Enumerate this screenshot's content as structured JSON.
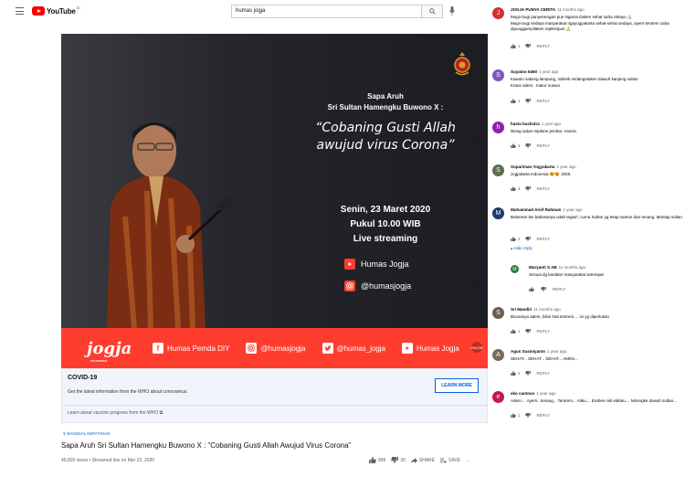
{
  "header": {
    "logo_text": "YouTube",
    "region_code": "ID",
    "search_value": "humas jogja"
  },
  "video": {
    "overlay": {
      "line1": "Sapa Aruh",
      "line2": "Sri Sultan Hamengku Buwono X :",
      "quote1": "“Cobaning Gusti Allah",
      "quote2": "awujud virus Corona”",
      "date": "Senin, 23 Maret 2020",
      "time": "Pukul 10.00 WIB",
      "live": "Live streaming",
      "social1": "Humas Jogja",
      "social2": "@humasjogja"
    },
    "bar": {
      "brand": "jogja",
      "brand_tag": "ISTIMEWA",
      "items": [
        "Humas Pemda DIY",
        "@humasjogja",
        "@humas_jogja",
        "Humas Jogja"
      ],
      "pause": "PAUSE"
    }
  },
  "info_panel": {
    "title": "COVID-19",
    "text": "Get the latest information from the WHO about coronavirus.",
    "link": "Learn about vaccine progress from the WHO ⧉",
    "button": "LEARN MORE"
  },
  "meta": {
    "location": "BANSSAL KEPATIHAN",
    "title": "Sapa Aruh Sri Sultan Hamengku Buwono X : “Cobaning Gusti Allah Awujud Virus Corona”",
    "stats": "49,820 views • Streamed live on Mar 23, 2020",
    "likes": "999",
    "dislikes": "30",
    "share": "SHARE",
    "save": "SAVE",
    "more": "..."
  },
  "comments": [
    {
      "author": "JOGJA PUNYA CERITA",
      "time": "11 months ago",
      "body": "Mugi-mugi panyenengan pun Ngarsa Dalem sehat saha rahayu 🙏\nMugi-mugi sedaya masyarakat ngayogyakarta sehat-sehat sedaya, ayem tentrem saha dipunggampilaken rejekinipun 🙏",
      "likes": "1",
      "reply": "REPLY",
      "avatar_letter": "J",
      "avatar_color": "#d32f2f"
    },
    {
      "author": "Suyatno 6450",
      "time": "1 year ago",
      "body": "Kawulo sakeng lampung, ndérek midangetaken dawuh kanjeng sultan\nKraos adem.. matur nuwun",
      "likes": "1",
      "reply": "REPLY",
      "avatar_letter": "S",
      "avatar_color": "#7e57c2"
    },
    {
      "author": "hasta buckxtra",
      "time": "1 year ago",
      "body": "Wong sabar rejekine jembar. Aamiin",
      "likes": "3",
      "reply": "REPLY",
      "avatar_letter": "h",
      "avatar_color": "#8e24aa"
    },
    {
      "author": "Supariman Yogyakarta",
      "time": "1 year ago",
      "body": "Jogjakarta Indonesia 😍😍 2020.",
      "likes": "4",
      "reply": "REPLY",
      "avatar_letter": "S",
      "avatar_color": "#5d6d4e"
    },
    {
      "author": "Muhammad Arief Rahman",
      "time": "1 year ago",
      "body": "Bubemar lan bahasanya udah tegas², cuma Sultan yg tetap santun dan tenang. Mantap sultan",
      "likes": "2",
      "reply": "REPLY",
      "hide_replies": "▴ Hide reply",
      "avatar_letter": "M",
      "avatar_color": "#1a3c6e"
    },
    {
      "author": "Muryanti S AB",
      "time": "11 months ago",
      "body": "Sesuai dg karakter masyarakat setempat",
      "likes": "",
      "reply": "REPLY",
      "avatar_letter": "M",
      "avatar_color": "#2e7d32"
    },
    {
      "author": "Sri Mandiri",
      "time": "11 months ago",
      "body": "Bicaranya adem, bikin hati tentrem.... ini yg diperlukan",
      "likes": "1",
      "reply": "REPLY",
      "avatar_letter": "S",
      "avatar_color": "#6d5d4b"
    },
    {
      "author": "Agus Susmiyanto",
      "time": "1 year ago",
      "body": "SEHAT... SEHAT... SEHAT... AMIIN...",
      "likes": "2",
      "reply": "REPLY",
      "avatar_letter": "A",
      "avatar_color": "#7a6a5a"
    },
    {
      "author": "eko cantoso",
      "time": "1 year ago",
      "body": "Adem.... Ayem.. tenang... Tentrem... Atiku.... Erebes mili elahku.... Mirengke dawuh sultan...",
      "likes": "1",
      "reply": "REPLY",
      "avatar_letter": "e",
      "avatar_color": "#c2185b"
    }
  ]
}
